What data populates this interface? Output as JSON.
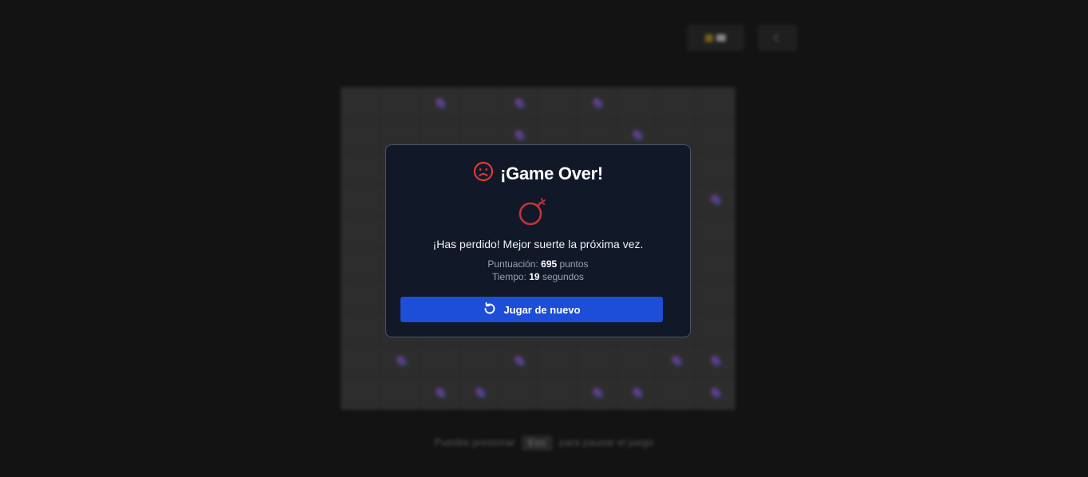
{
  "background": {
    "mode_button_icons": [
      "flag-icon",
      "chat-icon"
    ],
    "theme_button_label": "☾",
    "board": {
      "rows": 10,
      "cols": 10,
      "revealed_mines": [
        [
          0,
          2
        ],
        [
          0,
          4
        ],
        [
          0,
          6
        ],
        [
          1,
          4
        ],
        [
          1,
          7
        ],
        [
          3,
          9
        ],
        [
          8,
          1
        ],
        [
          8,
          4
        ],
        [
          8,
          8
        ],
        [
          8,
          9
        ],
        [
          9,
          2
        ],
        [
          9,
          3
        ],
        [
          9,
          6
        ],
        [
          9,
          7
        ],
        [
          9,
          9
        ]
      ]
    },
    "hint": {
      "before": "Puedes presionar",
      "key": "Esc",
      "after": "para pausar el juego"
    }
  },
  "modal": {
    "title": "¡Game Over!",
    "title_icon": "sad-face-icon",
    "illustration_icon": "bomb-icon",
    "message": "¡Has perdido! Mejor suerte la próxima vez.",
    "score_label": "Puntuación:",
    "score_value": "695",
    "score_unit": "puntos",
    "time_label": "Tiempo:",
    "time_value": "19",
    "time_unit": "segundos",
    "play_again_label": "Jugar de nuevo",
    "play_again_icon": "restart-icon",
    "accent_color": "#e03a3a",
    "button_color": "#1d4ed8"
  }
}
